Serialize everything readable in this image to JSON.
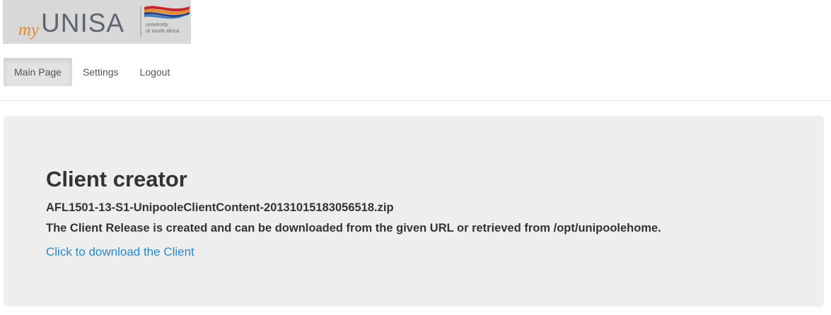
{
  "logo": {
    "prefix": "my",
    "brand": "UNISA",
    "tagline_line1": "university",
    "tagline_line2": "of south africa"
  },
  "nav": {
    "items": [
      {
        "label": "Main Page",
        "active": true
      },
      {
        "label": "Settings",
        "active": false
      },
      {
        "label": "Logout",
        "active": false
      }
    ]
  },
  "main": {
    "title": "Client creator",
    "filename": "AFL1501-13-S1-UnipooleClientContent-20131015183056518.zip",
    "message": "The Client Release is created and can be downloaded from the given URL or retrieved from /opt/unipoolehome.",
    "download_link": "Click to download the Client"
  },
  "colors": {
    "link": "#2a8ac4",
    "logo_orange": "#e8892b",
    "logo_grey": "#5e6670",
    "logo_red": "#c4272f",
    "logo_navy": "#2c3b7a",
    "jumbotron_bg": "#eeeeee"
  }
}
